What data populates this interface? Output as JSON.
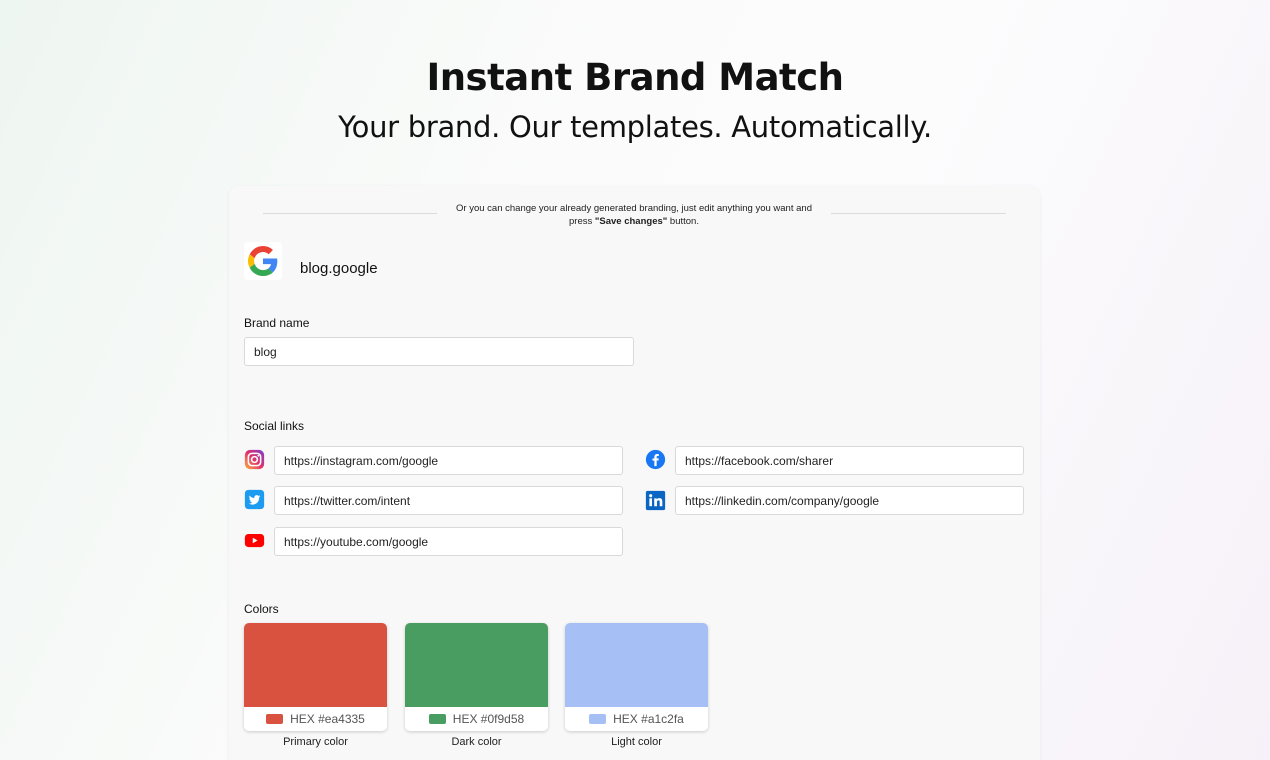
{
  "hero": {
    "title": "Instant Brand Match",
    "subtitle": "Your brand. Our templates. Automatically."
  },
  "notice": {
    "text_before": "Or you can change your already generated branding, just edit anything you want and press ",
    "bold": "\"Save changes\"",
    "text_after": " button."
  },
  "brand": {
    "domain": "blog.google",
    "logo_icon": "google-g-logo",
    "name_label": "Brand name",
    "name_value": "blog"
  },
  "social": {
    "label": "Social links",
    "links": {
      "instagram": "https://instagram.com/google",
      "facebook": "https://facebook.com/sharer",
      "twitter": "https://twitter.com/intent",
      "linkedin": "https://linkedin.com/company/google",
      "youtube": "https://youtube.com/google"
    }
  },
  "colors": {
    "label": "Colors",
    "items": [
      {
        "name": "Primary color",
        "hex_label": "HEX #ea4335",
        "hex": "#d95240"
      },
      {
        "name": "Dark color",
        "hex_label": "HEX #0f9d58",
        "hex": "#4a9d60"
      },
      {
        "name": "Light color",
        "hex_label": "HEX #a1c2fa",
        "hex": "#a6c0f5"
      }
    ]
  }
}
